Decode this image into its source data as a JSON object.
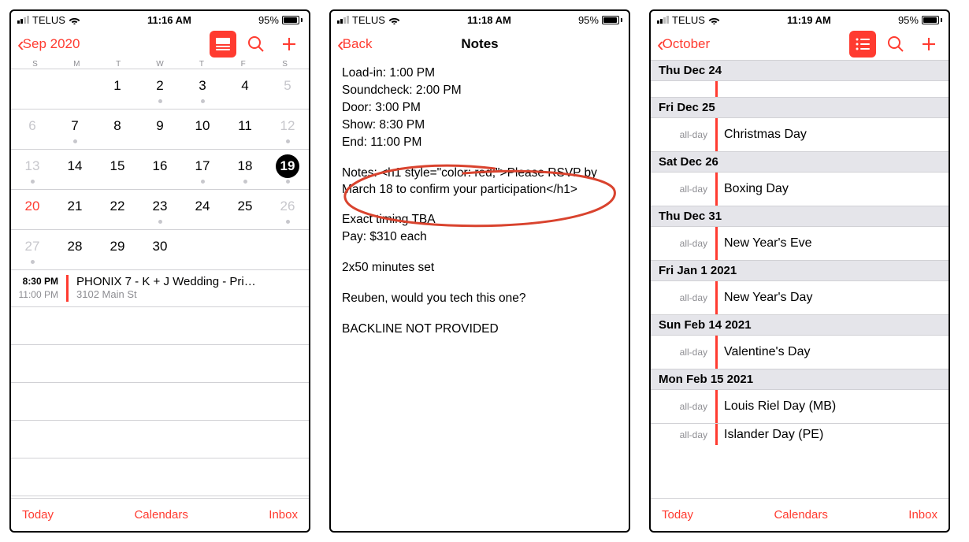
{
  "status": {
    "carrier": "TELUS",
    "battery_pct": "95%"
  },
  "phone1": {
    "time": "11:16 AM",
    "back": "Sep 2020",
    "dayheaders": [
      "S",
      "M",
      "T",
      "W",
      "T",
      "F",
      "S"
    ],
    "weeks": [
      [
        {
          "n": "",
          "g": true
        },
        {
          "n": "",
          "g": true
        },
        {
          "n": "1"
        },
        {
          "n": "2",
          "dot": true
        },
        {
          "n": "3",
          "dot": true
        },
        {
          "n": "4"
        },
        {
          "n": "5",
          "g": true
        }
      ],
      [
        {
          "n": "6",
          "g": true
        },
        {
          "n": "7",
          "dot": true
        },
        {
          "n": "8"
        },
        {
          "n": "9"
        },
        {
          "n": "10"
        },
        {
          "n": "11"
        },
        {
          "n": "12",
          "g": true,
          "dot": true
        }
      ],
      [
        {
          "n": "13",
          "dot": true,
          "g": true
        },
        {
          "n": "14"
        },
        {
          "n": "15"
        },
        {
          "n": "16"
        },
        {
          "n": "17",
          "dot": true
        },
        {
          "n": "18",
          "dot": true
        },
        {
          "n": "19",
          "sel": true,
          "dot": true
        }
      ],
      [
        {
          "n": "20",
          "red": true
        },
        {
          "n": "21"
        },
        {
          "n": "22"
        },
        {
          "n": "23",
          "dot": true
        },
        {
          "n": "24"
        },
        {
          "n": "25"
        },
        {
          "n": "26",
          "g": true,
          "dot": true
        }
      ],
      [
        {
          "n": "27",
          "dot": true,
          "g": true
        },
        {
          "n": "28"
        },
        {
          "n": "29"
        },
        {
          "n": "30"
        },
        {
          "n": "",
          "g": true
        },
        {
          "n": "",
          "g": true
        },
        {
          "n": "",
          "g": true
        }
      ]
    ],
    "event": {
      "start": "8:30 PM",
      "end": "11:00 PM",
      "title": "PHONIX 7 - K + J Wedding - Pri…",
      "subtitle": "3102 Main St"
    },
    "toolbar": {
      "today": "Today",
      "cal": "Calendars",
      "inbox": "Inbox"
    }
  },
  "phone2": {
    "time": "11:18 AM",
    "back": "Back",
    "title": "Notes",
    "lines": [
      "Load-in:  1:00 PM",
      "Soundcheck:  2:00 PM",
      "Door:  3:00 PM",
      "Show:  8:30 PM",
      "End: 11:00 PM",
      "",
      "Notes: <h1 style=\"color: red;\">Please RSVP by March 18 to confirm your participation</h1>",
      "",
      "Exact timing TBA",
      "Pay: $310 each",
      "",
      "2x50 minutes set",
      "",
      "Reuben, would you tech this one?",
      "",
      "BACKLINE NOT PROVIDED"
    ]
  },
  "phone3": {
    "time": "11:19 AM",
    "back": "October",
    "sections": [
      {
        "head_dow": "Thu",
        "head_rest": "Dec 24",
        "rows": [
          {
            "narrow": true
          }
        ]
      },
      {
        "head_dow": "Fri",
        "head_rest": "Dec 25",
        "rows": [
          {
            "allday": "all-day",
            "label": "Christmas Day"
          }
        ]
      },
      {
        "head_dow": "Sat",
        "head_rest": "Dec 26",
        "rows": [
          {
            "allday": "all-day",
            "label": "Boxing Day"
          }
        ]
      },
      {
        "head_dow": "Thu",
        "head_rest": "Dec 31",
        "rows": [
          {
            "allday": "all-day",
            "label": "New Year's Eve"
          }
        ]
      },
      {
        "head_dow": "Fri",
        "head_rest": "Jan 1 2021",
        "rows": [
          {
            "allday": "all-day",
            "label": "New Year's Day"
          }
        ]
      },
      {
        "head_dow": "Sun",
        "head_rest": "Feb 14 2021",
        "rows": [
          {
            "allday": "all-day",
            "label": "Valentine's Day"
          }
        ]
      },
      {
        "head_dow": "Mon",
        "head_rest": "Feb 15 2021",
        "rows": [
          {
            "allday": "all-day",
            "label": "Louis Riel Day (MB)"
          },
          {
            "allday": "all-day",
            "label": "Islander Day (PE)",
            "cut": true
          }
        ]
      }
    ],
    "toolbar": {
      "today": "Today",
      "cal": "Calendars",
      "inbox": "Inbox"
    }
  }
}
